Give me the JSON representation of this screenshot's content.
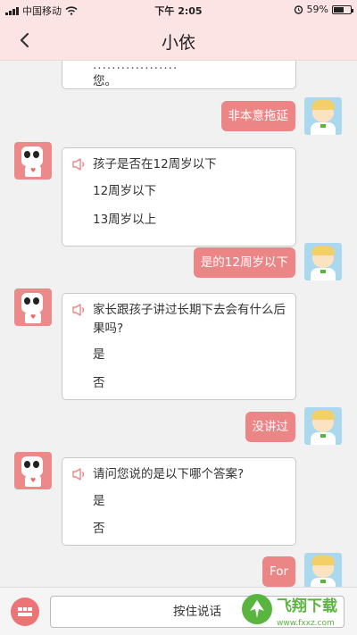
{
  "status_bar": {
    "carrier": "中国移动",
    "time": "下午 2:05",
    "battery": "59%",
    "battery_level": 0.59
  },
  "header": {
    "title": "小依"
  },
  "messages": [
    {
      "role": "bot",
      "partial_lines": [
        "..................",
        "您。"
      ]
    },
    {
      "role": "user",
      "text": "非本意拖延"
    },
    {
      "role": "bot",
      "question": "孩子是否在12周岁以下",
      "options": [
        "12周岁以下",
        "13周岁以上"
      ]
    },
    {
      "role": "user",
      "text": "是的12周岁以下"
    },
    {
      "role": "bot",
      "question": "家长跟孩子讲过长期下去会有什么后果吗?",
      "options": [
        "是",
        "否"
      ]
    },
    {
      "role": "user",
      "text": "没讲过"
    },
    {
      "role": "bot",
      "question": "请问您说的是以下哪个答案?",
      "options": [
        "是",
        "否"
      ]
    },
    {
      "role": "user",
      "text": "For"
    }
  ],
  "input_bar": {
    "hold_to_talk": "按住说话"
  },
  "watermark": {
    "text": "飞翔下载",
    "url": "www.fxxz.com"
  },
  "colors": {
    "accent": "#ec8585",
    "nav_bg": "#fde4e4",
    "watermark": "#59b53e"
  },
  "icons": {
    "back": "chevron-left-icon",
    "speaker": "speaker-icon",
    "keyboard": "keyboard-icon"
  }
}
